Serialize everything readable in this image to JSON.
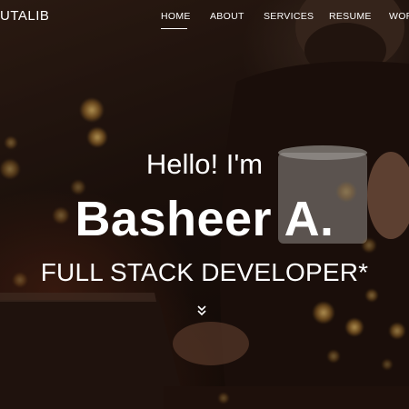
{
  "navbar": {
    "brand": "UTALIB",
    "items": [
      {
        "label": "HOME",
        "active": true
      },
      {
        "label": "ABOUT"
      },
      {
        "label": "SERVICES"
      },
      {
        "label": "RESUME"
      },
      {
        "label": "WOR"
      }
    ]
  },
  "hero": {
    "greeting": "Hello! I'm",
    "name": "Basheer A.",
    "role": "FULL STACK DEVELOPER*",
    "scroll_icon": "double-chevron-down-icon"
  },
  "colors": {
    "text": "#ffffff",
    "background": "#24150f",
    "bokeh": "#f0b050"
  }
}
